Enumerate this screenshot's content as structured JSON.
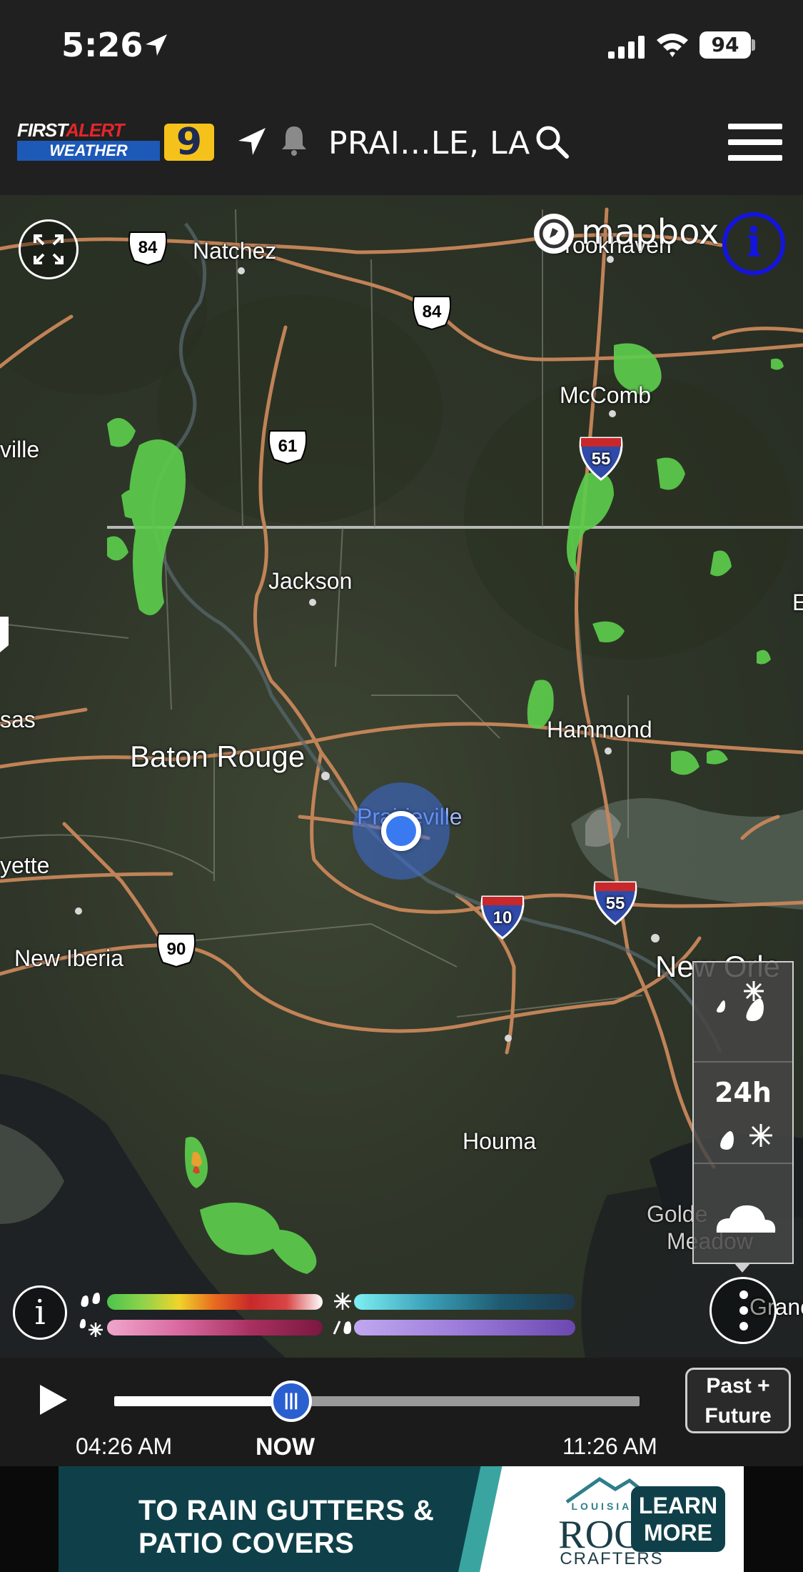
{
  "status_bar": {
    "time": "5:26",
    "battery": "94"
  },
  "header": {
    "logo_first": "FIRST",
    "logo_alert": "ALERT",
    "logo_weather": "WEATHER",
    "logo_channel": "9",
    "location": "PRAI...LE, LA"
  },
  "map": {
    "attribution": "mapbox",
    "info_glyph": "i",
    "cities": {
      "natchez": "Natchez",
      "brookhaven": "Brookhaven",
      "mccomb": "McComb",
      "jackson": "Jackson",
      "baton_rouge": "Baton Rouge",
      "hammond": "Hammond",
      "prairieville": "Prairieville",
      "new_iberia": "New Iberia",
      "new_orleans": "New Orle",
      "houma": "Houma",
      "golden_meadow_1": "Golde",
      "golden_meadow_2": "Meadow",
      "grand_isle": "Granc",
      "edge_ville": "ville",
      "edge_sas": "sas",
      "edge_yette": "yette",
      "edge_e": "E"
    },
    "shields": {
      "us84_a": "84",
      "us84_b": "84",
      "us61": "61",
      "i55_a": "55",
      "i55_b": "55",
      "i10": "10",
      "us90": "90"
    },
    "layers": {
      "hours_label": "24h"
    }
  },
  "legend": {
    "info_glyph": "i"
  },
  "timeline": {
    "start_time": "04:26 AM",
    "now_label": "NOW",
    "end_time": "11:26 AM",
    "scrubber_glyph": "|||",
    "mode_line_1": "Past +",
    "mode_line_2": "Future"
  },
  "ad": {
    "headline_1": "TO RAIN GUTTERS &",
    "headline_2": "PATIO COVERS",
    "brand_small": "LOUISIANA",
    "brand_main": "ROOF",
    "brand_sub": "CRAFTERS",
    "cta_line_1": "LEARN",
    "cta_line_2": "MORE"
  },
  "colors": {
    "accent": "#2a5fd0",
    "brand_blue": "#1d5ab8",
    "brand_red": "#e3262a",
    "brand_yellow": "#f4c21b",
    "radar_green": "#5ccc4c",
    "road": "#d08a5a"
  },
  "icons": [
    "location-arrow-icon",
    "signal-icon",
    "wifi-icon",
    "battery-icon",
    "navigation-arrow-icon",
    "bell-icon",
    "search-icon",
    "menu-icon",
    "fullscreen-icon",
    "mapbox-icon",
    "info-icon",
    "play-icon",
    "rain-drop-icon",
    "snowflake-icon",
    "cloud-icon",
    "more-options-icon"
  ]
}
